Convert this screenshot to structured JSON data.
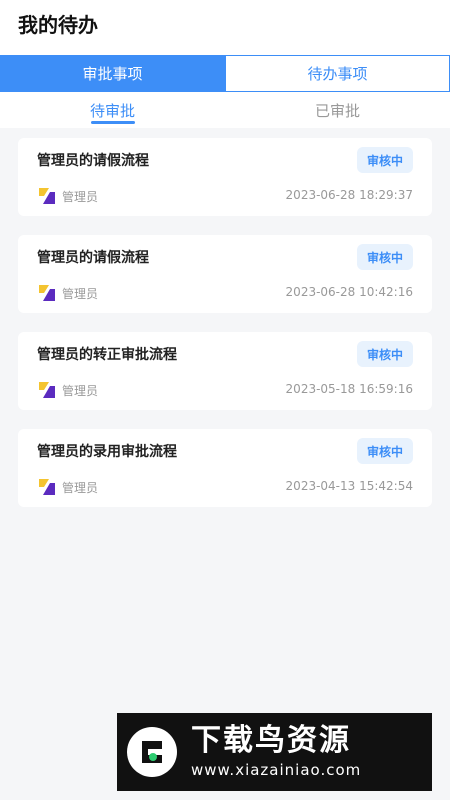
{
  "header": {
    "title": "我的待办"
  },
  "segment": {
    "approval_label": "审批事项",
    "todo_label": "待办事项"
  },
  "subtabs": {
    "pending_label": "待审批",
    "approved_label": "已审批"
  },
  "items": [
    {
      "title": "管理员的请假流程",
      "status": "审核中",
      "user": "管理员",
      "time": "2023-06-28 18:29:37"
    },
    {
      "title": "管理员的请假流程",
      "status": "审核中",
      "user": "管理员",
      "time": "2023-06-28 10:42:16"
    },
    {
      "title": "管理员的转正审批流程",
      "status": "审核中",
      "user": "管理员",
      "time": "2023-05-18 16:59:16"
    },
    {
      "title": "管理员的录用审批流程",
      "status": "审核中",
      "user": "管理员",
      "time": "2023-04-13 15:42:54"
    }
  ],
  "watermark": {
    "brand": "下载鸟资源",
    "url": "www.xiazainiao.com"
  },
  "colors": {
    "accent": "#3d8ef7",
    "badge_bg": "#e8f2fd",
    "page_bg": "#f5f6f8"
  }
}
